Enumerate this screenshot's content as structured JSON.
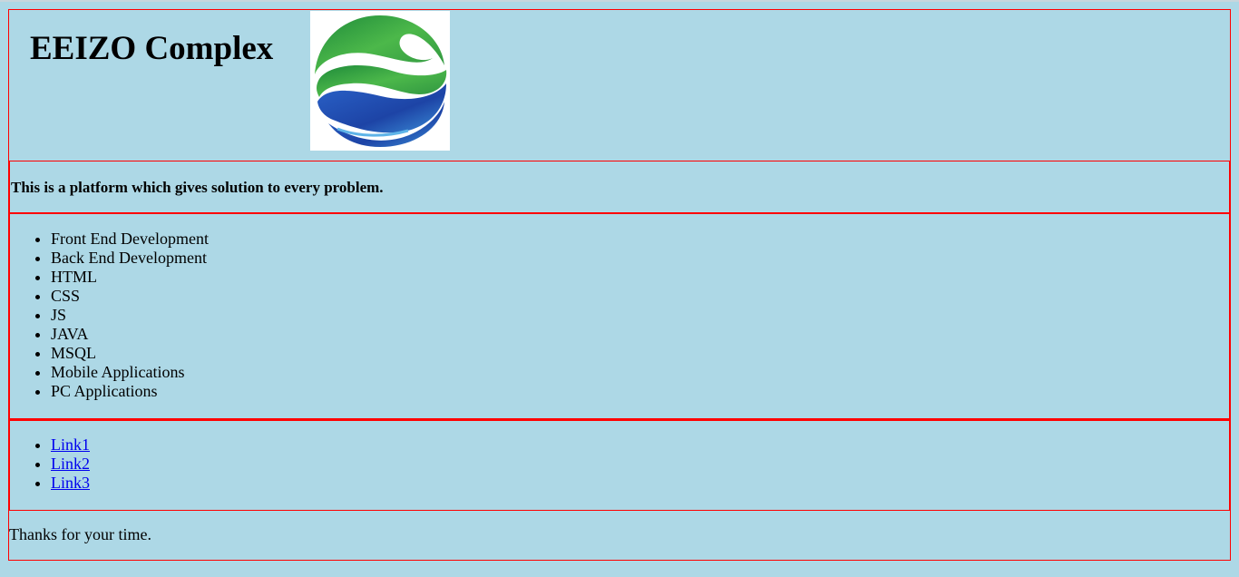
{
  "header": {
    "title": "EEIZO Complex",
    "logo_icon": "green-blue-swirl-sphere-logo"
  },
  "tagline": "This is a platform which gives solution to every problem.",
  "services": [
    "Front End Development",
    "Back End Development",
    "HTML",
    "CSS",
    "JS",
    "JAVA",
    "MSQL",
    "Mobile Applications",
    "PC Applications"
  ],
  "links": [
    "Link1",
    "Link2",
    "Link3"
  ],
  "footer": {
    "text": "Thanks for your time."
  },
  "colors": {
    "background": "#add8e6",
    "border": "#ff0000",
    "link": "#0000ee",
    "logo_green": "#3aa845",
    "logo_blue": "#1f4fb0"
  }
}
